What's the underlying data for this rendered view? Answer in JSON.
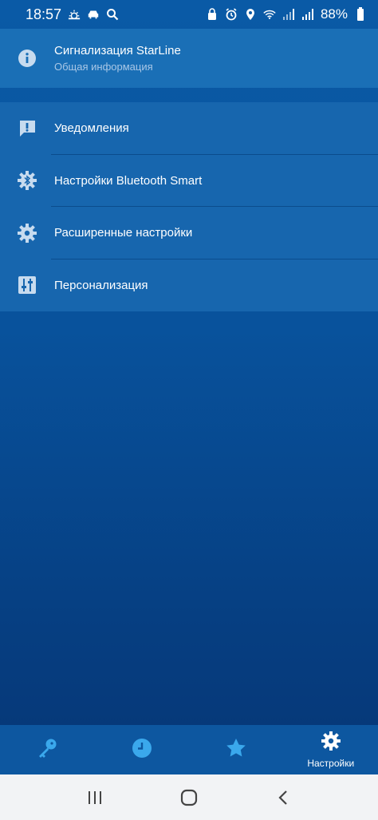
{
  "status_bar": {
    "time": "18:57",
    "battery": "88%",
    "left_icons": [
      "weather-icon",
      "car-icon",
      "search-icon"
    ],
    "right_icons": [
      "lock-icon",
      "alarm-icon",
      "location-icon",
      "wifi-icon",
      "signal-icon",
      "signal-icon",
      "battery-icon"
    ]
  },
  "info": {
    "title": "Сигнализация StarLine",
    "subtitle": "Общая информация",
    "icon": "info-icon"
  },
  "menu": {
    "items": [
      {
        "label": "Уведомления",
        "icon": "notification-icon"
      },
      {
        "label": "Настройки Bluetooth Smart",
        "icon": "bluetooth-gear-icon"
      },
      {
        "label": "Расширенные настройки",
        "icon": "gear-icon"
      },
      {
        "label": "Персонализация",
        "icon": "sliders-icon"
      }
    ]
  },
  "bottom_nav": {
    "items": [
      {
        "icon": "key-icon",
        "label": ""
      },
      {
        "icon": "clock-icon",
        "label": ""
      },
      {
        "icon": "star-icon",
        "label": ""
      },
      {
        "icon": "gear-icon",
        "label": "Настройки"
      }
    ],
    "accent": "#3aa8ec"
  },
  "system_nav": {
    "buttons": [
      "recents-icon",
      "home-icon",
      "back-icon"
    ]
  }
}
